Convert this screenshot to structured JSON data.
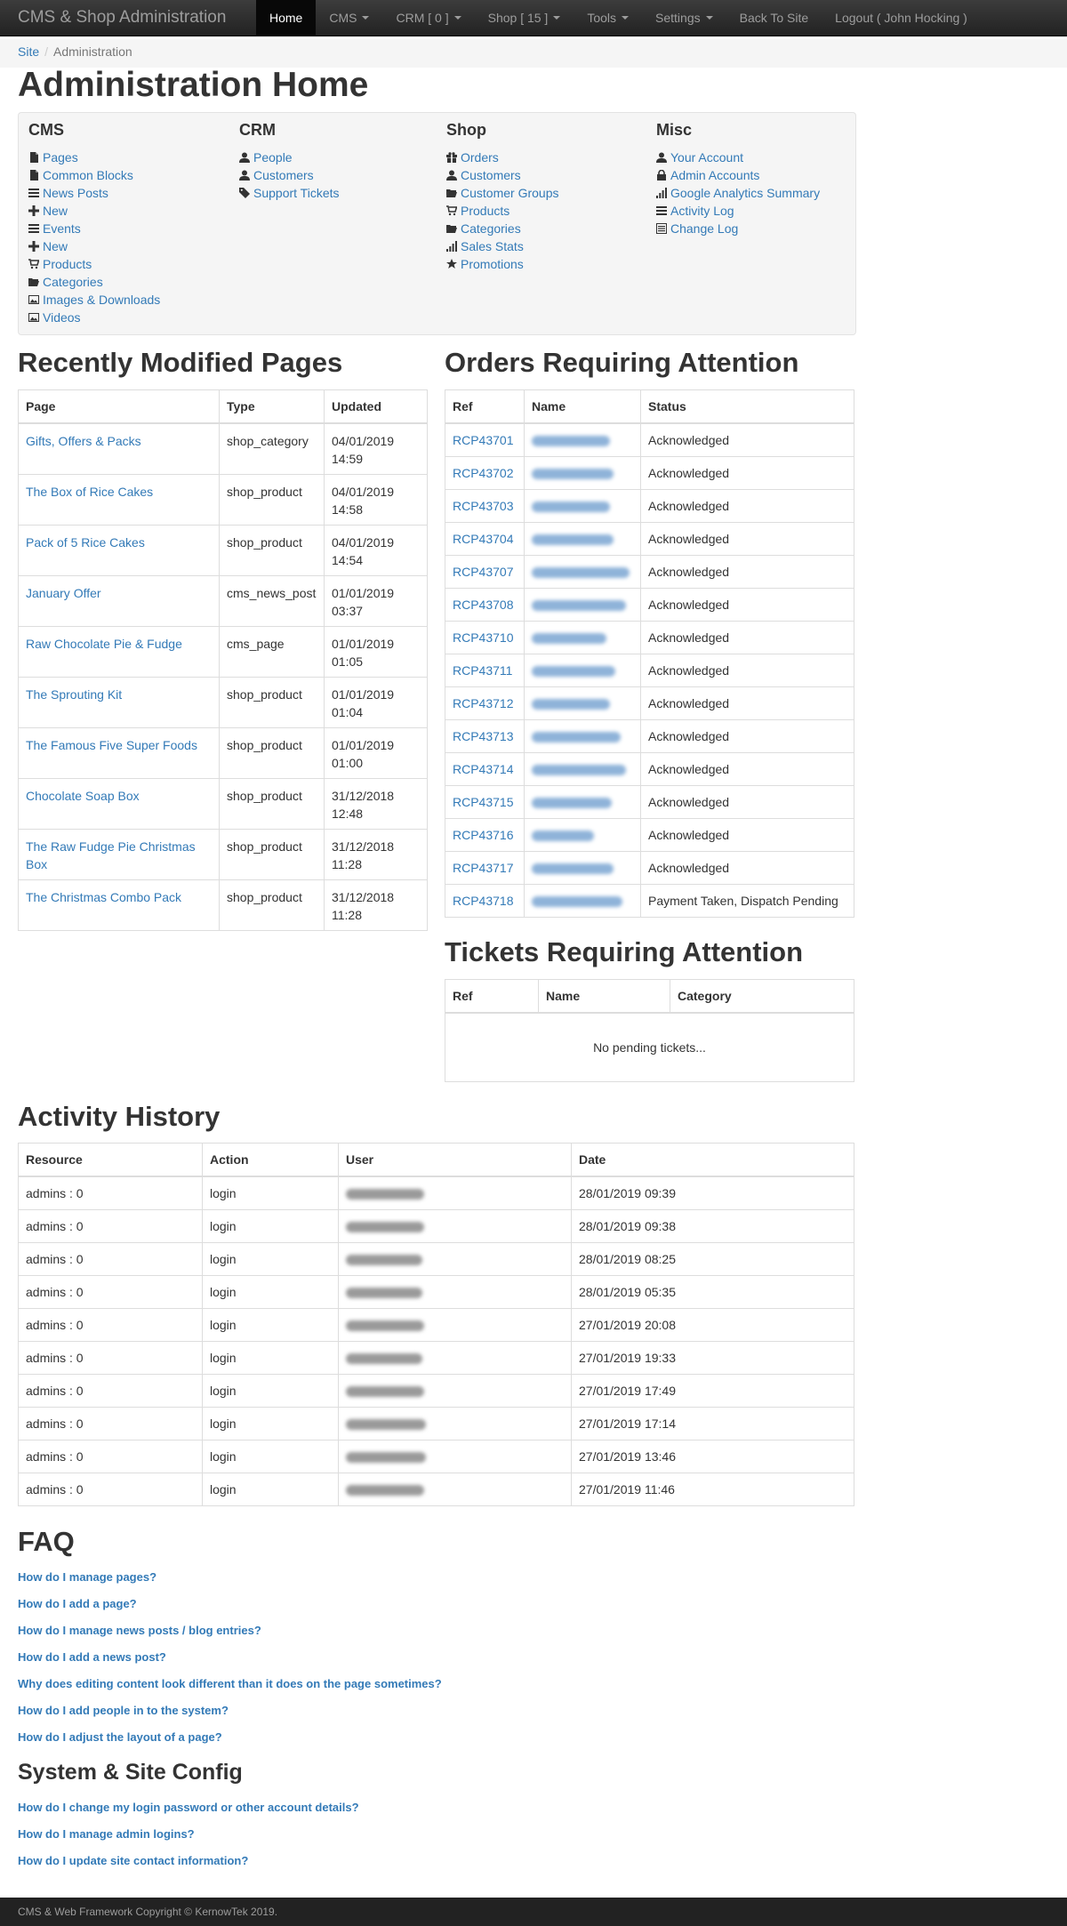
{
  "navbar": {
    "brand": "CMS & Shop Administration",
    "items": [
      {
        "label": "Home",
        "active": true,
        "caret": false
      },
      {
        "label": "CMS",
        "caret": true
      },
      {
        "label": "CRM [ 0 ]",
        "caret": true
      },
      {
        "label": "Shop [ 15 ]",
        "caret": true
      },
      {
        "label": "Tools",
        "caret": true
      },
      {
        "label": "Settings",
        "caret": true
      },
      {
        "label": "Back To Site",
        "caret": false
      },
      {
        "label": "Logout ( John Hocking )",
        "caret": false
      }
    ]
  },
  "breadcrumb": {
    "site": "Site",
    "current": "Administration"
  },
  "page_title": "Administration Home",
  "well": {
    "cms": {
      "title": "CMS",
      "links": [
        {
          "label": "Pages",
          "icon": "file-icon"
        },
        {
          "label": "Common Blocks",
          "icon": "file-icon"
        },
        {
          "label": "News Posts",
          "icon": "list-icon"
        },
        {
          "label": "New",
          "icon": "plus-icon"
        },
        {
          "label": "Events",
          "icon": "list-icon"
        },
        {
          "label": "New",
          "icon": "plus-icon"
        },
        {
          "label": "Products",
          "icon": "cart-icon"
        },
        {
          "label": "Categories",
          "icon": "folder-icon"
        },
        {
          "label": "Images & Downloads",
          "icon": "picture-icon"
        },
        {
          "label": "Videos",
          "icon": "picture-icon"
        }
      ]
    },
    "crm": {
      "title": "CRM",
      "links": [
        {
          "label": "People",
          "icon": "user-icon"
        },
        {
          "label": "Customers",
          "icon": "user-icon"
        },
        {
          "label": "Support Tickets",
          "icon": "tag-icon"
        }
      ]
    },
    "shop": {
      "title": "Shop",
      "links": [
        {
          "label": "Orders",
          "icon": "gift-icon"
        },
        {
          "label": "Customers",
          "icon": "user-icon"
        },
        {
          "label": "Customer Groups",
          "icon": "folder-icon"
        },
        {
          "label": "Products",
          "icon": "cart-icon"
        },
        {
          "label": "Categories",
          "icon": "folder-icon"
        },
        {
          "label": "Sales Stats",
          "icon": "signal-icon"
        },
        {
          "label": "Promotions",
          "icon": "star-icon"
        }
      ]
    },
    "misc": {
      "title": "Misc",
      "links": [
        {
          "label": "Your Account",
          "icon": "user-icon"
        },
        {
          "label": "Admin Accounts",
          "icon": "lock-icon"
        },
        {
          "label": "Google Analytics Summary",
          "icon": "signal-icon"
        },
        {
          "label": "Activity Log",
          "icon": "list-icon"
        },
        {
          "label": "Change Log",
          "icon": "list-alt-icon"
        }
      ]
    }
  },
  "recent_pages": {
    "title": "Recently Modified Pages",
    "headers": [
      "Page",
      "Type",
      "Updated"
    ],
    "rows": [
      {
        "page": "Gifts, Offers & Packs",
        "type": "shop_category",
        "date": "04/01/2019",
        "time": "14:59"
      },
      {
        "page": "The Box of Rice Cakes",
        "type": "shop_product",
        "date": "04/01/2019",
        "time": "14:58"
      },
      {
        "page": "Pack of 5 Rice Cakes",
        "type": "shop_product",
        "date": "04/01/2019",
        "time": "14:54"
      },
      {
        "page": "January Offer",
        "type": "cms_news_post",
        "date": "01/01/2019",
        "time": "03:37"
      },
      {
        "page": "Raw Chocolate Pie & Fudge",
        "type": "cms_page",
        "date": "01/01/2019",
        "time": "01:05"
      },
      {
        "page": "The Sprouting Kit",
        "type": "shop_product",
        "date": "01/01/2019",
        "time": "01:04"
      },
      {
        "page": "The Famous Five Super Foods",
        "type": "shop_product",
        "date": "01/01/2019",
        "time": "01:00"
      },
      {
        "page": "Chocolate Soap Box",
        "type": "shop_product",
        "date": "31/12/2018",
        "time": "12:48"
      },
      {
        "page": "The Raw Fudge Pie Christmas Box",
        "type": "shop_product",
        "date": "31/12/2018",
        "time": "11:28"
      },
      {
        "page": "The Christmas Combo Pack",
        "type": "shop_product",
        "date": "31/12/2018",
        "time": "11:28"
      }
    ]
  },
  "orders": {
    "title": "Orders Requiring Attention",
    "headers": [
      "Ref",
      "Name",
      "Status"
    ],
    "rows": [
      {
        "ref": "RCP43701",
        "status": "Acknowledged"
      },
      {
        "ref": "RCP43702",
        "status": "Acknowledged"
      },
      {
        "ref": "RCP43703",
        "status": "Acknowledged"
      },
      {
        "ref": "RCP43704",
        "status": "Acknowledged"
      },
      {
        "ref": "RCP43707",
        "status": "Acknowledged"
      },
      {
        "ref": "RCP43708",
        "status": "Acknowledged"
      },
      {
        "ref": "RCP43710",
        "status": "Acknowledged"
      },
      {
        "ref": "RCP43711",
        "status": "Acknowledged"
      },
      {
        "ref": "RCP43712",
        "status": "Acknowledged"
      },
      {
        "ref": "RCP43713",
        "status": "Acknowledged"
      },
      {
        "ref": "RCP43714",
        "status": "Acknowledged"
      },
      {
        "ref": "RCP43715",
        "status": "Acknowledged"
      },
      {
        "ref": "RCP43716",
        "status": "Acknowledged"
      },
      {
        "ref": "RCP43717",
        "status": "Acknowledged"
      },
      {
        "ref": "RCP43718",
        "status": "Payment Taken, Dispatch Pending"
      }
    ]
  },
  "tickets": {
    "title": "Tickets Requiring Attention",
    "headers": [
      "Ref",
      "Name",
      "Category"
    ],
    "empty": "No pending tickets..."
  },
  "activity": {
    "title": "Activity History",
    "headers": [
      "Resource",
      "Action",
      "User",
      "Date"
    ],
    "rows": [
      {
        "resource": "admins : 0",
        "action": "login",
        "date": "28/01/2019 09:39"
      },
      {
        "resource": "admins : 0",
        "action": "login",
        "date": "28/01/2019 09:38"
      },
      {
        "resource": "admins : 0",
        "action": "login",
        "date": "28/01/2019 08:25"
      },
      {
        "resource": "admins : 0",
        "action": "login",
        "date": "28/01/2019 05:35"
      },
      {
        "resource": "admins : 0",
        "action": "login",
        "date": "27/01/2019 20:08"
      },
      {
        "resource": "admins : 0",
        "action": "login",
        "date": "27/01/2019 19:33"
      },
      {
        "resource": "admins : 0",
        "action": "login",
        "date": "27/01/2019 17:49"
      },
      {
        "resource": "admins : 0",
        "action": "login",
        "date": "27/01/2019 17:14"
      },
      {
        "resource": "admins : 0",
        "action": "login",
        "date": "27/01/2019 13:46"
      },
      {
        "resource": "admins : 0",
        "action": "login",
        "date": "27/01/2019 11:46"
      }
    ]
  },
  "faq": {
    "title": "FAQ",
    "items": [
      "How do I manage pages?",
      "How do I add a page?",
      "How do I manage news posts / blog entries?",
      "How do I add a news post?",
      "Why does editing content look different than it does on the page sometimes?",
      "How do I add people in to the system?",
      "How do I adjust the layout of a page?"
    ]
  },
  "system": {
    "title": "System & Site Config",
    "items": [
      "How do I change my login password or other account details?",
      "How do I manage admin logins?",
      "How do I update site contact information?"
    ]
  },
  "footer": "CMS & Web Framework Copyright © KernowTek 2019."
}
